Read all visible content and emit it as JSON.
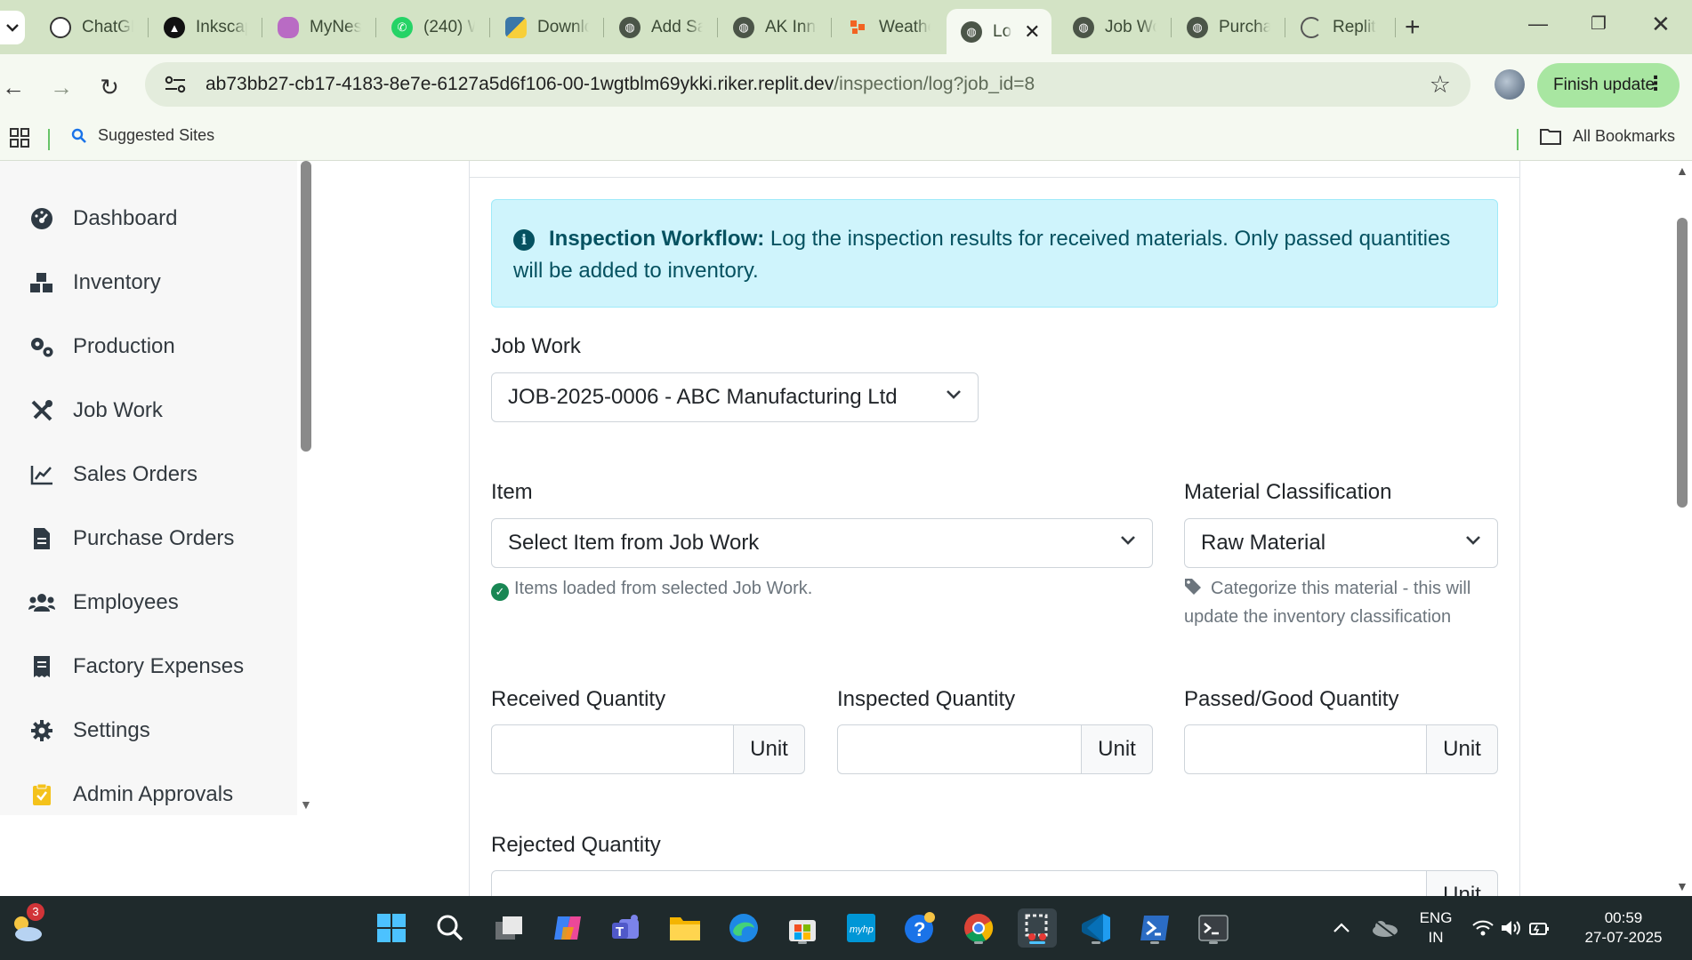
{
  "browser": {
    "tabs": [
      {
        "label": "ChatGP",
        "icon": "chatgpt-icon"
      },
      {
        "label": "Inkscap",
        "icon": "inkscape-icon"
      },
      {
        "label": "MyNes",
        "icon": "mynest-icon"
      },
      {
        "label": "(240) W",
        "icon": "whatsapp-icon"
      },
      {
        "label": "Downlo",
        "icon": "python-icon"
      },
      {
        "label": "Add Sa",
        "icon": "globe-icon"
      },
      {
        "label": "AK Inno",
        "icon": "globe-icon"
      },
      {
        "label": "Weathe",
        "icon": "weather-icon"
      },
      {
        "label": "Lo",
        "icon": "globe-icon",
        "active": true
      },
      {
        "label": "Job Wo",
        "icon": "globe-icon"
      },
      {
        "label": "Purcha",
        "icon": "globe-icon"
      },
      {
        "label": "Replit",
        "icon": "loading-icon"
      }
    ],
    "url_host": "ab73bb27-cb17-4183-8e7e-6127a5d6f106-00-1wgtblm69ykki.riker.replit.dev",
    "url_path": "/inspection/log?job_id=8",
    "finish_update": "Finish update",
    "bookmarks": {
      "suggested": "Suggested Sites",
      "all": "All Bookmarks"
    }
  },
  "sidebar": {
    "items": [
      {
        "label": "Dashboard",
        "icon": "dashboard-icon"
      },
      {
        "label": "Inventory",
        "icon": "inventory-icon"
      },
      {
        "label": "Production",
        "icon": "production-icon"
      },
      {
        "label": "Job Work",
        "icon": "tools-icon"
      },
      {
        "label": "Sales Orders",
        "icon": "chart-line-icon"
      },
      {
        "label": "Purchase Orders",
        "icon": "file-icon"
      },
      {
        "label": "Employees",
        "icon": "users-icon"
      },
      {
        "label": "Factory Expenses",
        "icon": "receipt-icon"
      },
      {
        "label": "Settings",
        "icon": "gear-icon"
      },
      {
        "label": "Admin Approvals",
        "icon": "clipboard-check-icon"
      }
    ]
  },
  "form": {
    "alert_title": "Inspection Workflow:",
    "alert_text": " Log the inspection results for received materials. Only passed quantities will be added to inventory.",
    "job_work_label": "Job Work",
    "job_work_value": "JOB-2025-0006 - ABC Manufacturing Ltd",
    "item_label": "Item",
    "item_value": "Select Item from Job Work",
    "item_help": "Items loaded from selected Job Work.",
    "classification_label": "Material Classification",
    "classification_value": "Raw Material",
    "classification_help": "Categorize this material - this will update the inventory classification",
    "received_label": "Received Quantity",
    "inspected_label": "Inspected Quantity",
    "passed_label": "Passed/Good Quantity",
    "rejected_label": "Rejected Quantity",
    "unit": "Unit"
  },
  "taskbar": {
    "weather_badge": "3",
    "lang_line1": "ENG",
    "lang_line2": "IN",
    "time": "00:59",
    "date": "27-07-2025"
  },
  "colors": {
    "alert_bg": "#cff4fc",
    "alert_text": "#055160",
    "success": "#198754",
    "finish_update_bg": "#a8e6a1"
  }
}
